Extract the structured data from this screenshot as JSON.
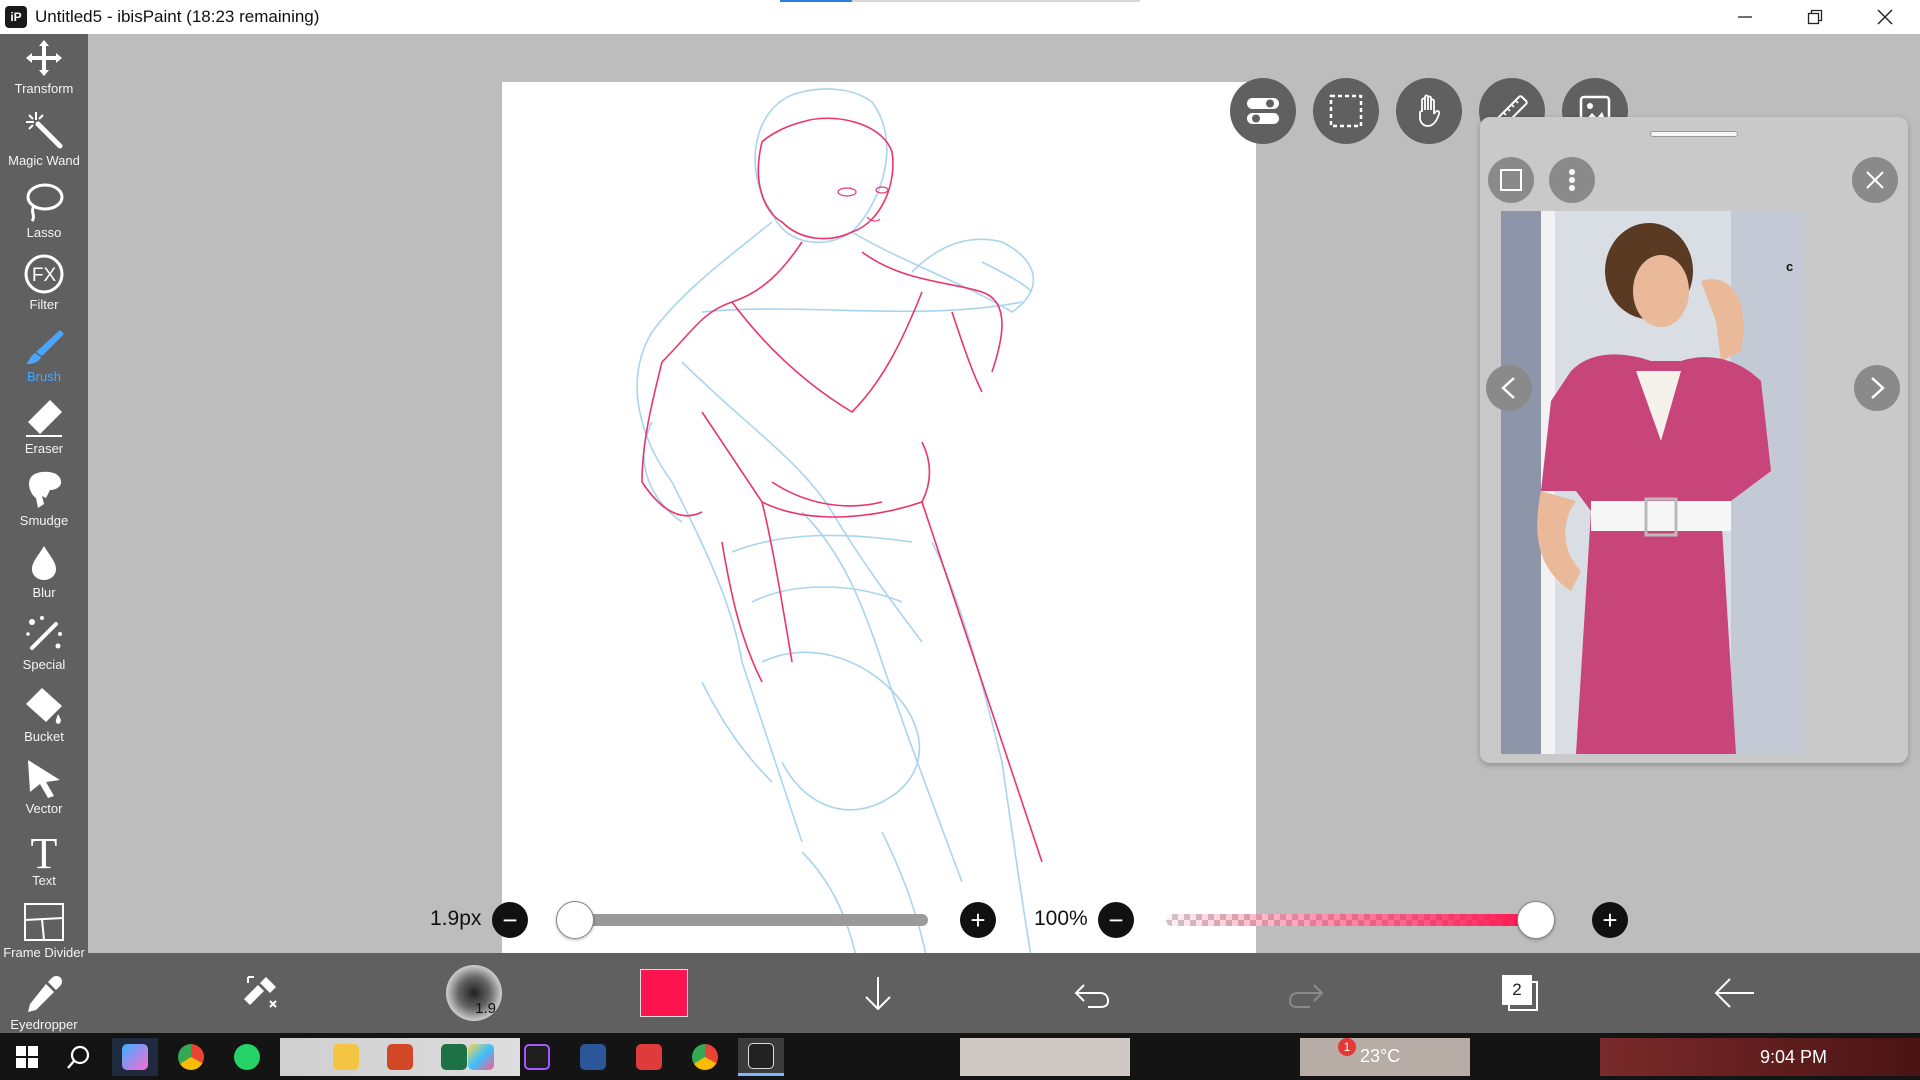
{
  "window": {
    "title": "Untitled5 - ibisPaint (18:23 remaining)",
    "app_icon_label": "iP",
    "controls": [
      "minimize",
      "restore",
      "close"
    ]
  },
  "toolbar": {
    "tools": [
      {
        "label": "Transform",
        "icon": "move-icon"
      },
      {
        "label": "Magic Wand",
        "icon": "magic-wand-icon"
      },
      {
        "label": "Lasso",
        "icon": "lasso-icon"
      },
      {
        "label": "Filter",
        "icon": "fx-icon",
        "glyph": "FX"
      },
      {
        "label": "Brush",
        "icon": "brush-icon",
        "active": true
      },
      {
        "label": "Eraser",
        "icon": "eraser-icon"
      },
      {
        "label": "Smudge",
        "icon": "smudge-icon"
      },
      {
        "label": "Blur",
        "icon": "blur-drop-icon"
      },
      {
        "label": "Special",
        "icon": "special-pen-icon"
      },
      {
        "label": "Bucket",
        "icon": "bucket-icon"
      },
      {
        "label": "Vector",
        "icon": "vector-cursor-icon"
      },
      {
        "label": "Text",
        "icon": "text-icon",
        "glyph": "T"
      },
      {
        "label": "Frame Divider",
        "icon": "frame-divider-icon"
      },
      {
        "label": "Eyedropper",
        "icon": "eyedropper-icon"
      }
    ]
  },
  "top_right_buttons": [
    "toggle-icon",
    "selection-icon",
    "hand-icon",
    "ruler-icon",
    "reference-image-icon"
  ],
  "reference_panel": {
    "buttons": [
      "square-icon",
      "more-vertical-icon",
      "close-icon"
    ],
    "photo_alt_letter": "c",
    "nav": [
      "chevron-left-icon",
      "chevron-right-icon"
    ]
  },
  "sliders": {
    "brush_size": {
      "value_label": "1.9px",
      "value": 0.02
    },
    "opacity": {
      "value_label": "100%",
      "value": 1.0
    }
  },
  "bottom_bar": {
    "brush_preview_label": "1.9",
    "color": "#ff1450",
    "layer_count": "2",
    "items": [
      "swap-icon",
      "brush-preview",
      "color-swatch",
      "download-arrow-icon",
      "undo-icon",
      "redo-icon",
      "layers-icon",
      "back-arrow-icon"
    ]
  },
  "taskbar": {
    "weather": "23°C",
    "notification_badge": "1",
    "time": "9:04 PM"
  },
  "colors": {
    "toolbar_bg": "#606060",
    "workspace_bg": "#bdbdbd",
    "accent_blue": "#4aa6ff",
    "sketch_red": "#e8366b",
    "sketch_blue": "#a9d4f0",
    "dress_pink": "#c8457a"
  }
}
